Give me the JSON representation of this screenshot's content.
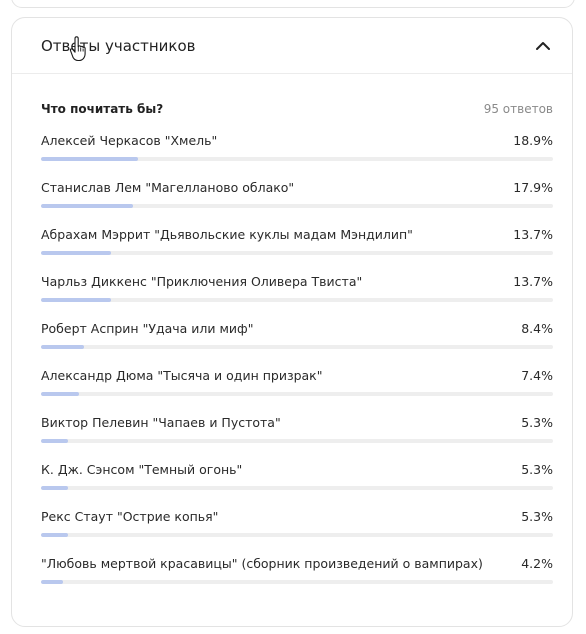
{
  "panel": {
    "title": "Ответы участников",
    "collapse_icon": "chevron-up-icon"
  },
  "poll": {
    "question": "Что почитать бы?",
    "total": "95 ответов",
    "options": [
      {
        "label": "Алексей Черкасов \"Хмель\"",
        "percent": "18.9%",
        "value": 18.9
      },
      {
        "label": "Станислав Лем \"Магелланово облако\"",
        "percent": "17.9%",
        "value": 17.9
      },
      {
        "label": "Абрахам Мэррит \"Дьявольские куклы мадам Мэндилип\"",
        "percent": "13.7%",
        "value": 13.7
      },
      {
        "label": "Чарльз Диккенс \"Приключения Оливера Твиста\"",
        "percent": "13.7%",
        "value": 13.7
      },
      {
        "label": "Роберт Асприн \"Удача или миф\"",
        "percent": "8.4%",
        "value": 8.4
      },
      {
        "label": "Александр Дюма \"Тысяча и один призрак\"",
        "percent": "7.4%",
        "value": 7.4
      },
      {
        "label": "Виктор Пелевин \"Чапаев и Пустота\"",
        "percent": "5.3%",
        "value": 5.3
      },
      {
        "label": "К. Дж. Сэнсом \"Темный огонь\"",
        "percent": "5.3%",
        "value": 5.3
      },
      {
        "label": "Рекс Стаут \"Острие копья\"",
        "percent": "5.3%",
        "value": 5.3
      },
      {
        "label": "\"Любовь мертвой красавицы\" (сборник произведений о вампирах)",
        "percent": "4.2%",
        "value": 4.2
      }
    ]
  },
  "colors": {
    "bar_fill": "#b9c8ee",
    "bar_track": "#eeeeee",
    "border": "#e3e3e3"
  }
}
